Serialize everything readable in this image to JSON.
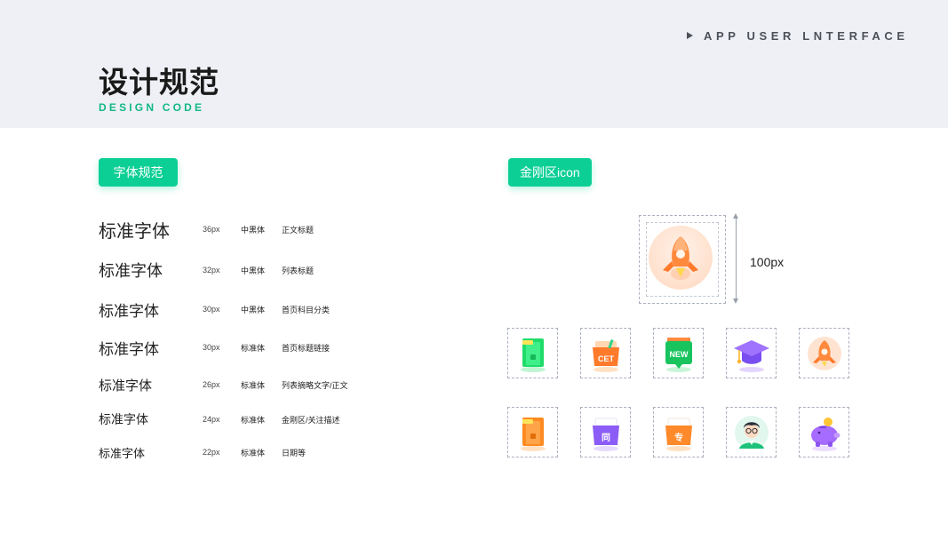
{
  "header": {
    "top_right": "APP USER LNTERFACE",
    "title": "设计规范",
    "subtitle": "DESIGN CODE"
  },
  "sections": {
    "font_tag": "字体规范",
    "icon_tag": "金刚区icon"
  },
  "font_specs": [
    {
      "sample": "标准字体",
      "size": "36px",
      "weight": "中黑体",
      "usage": "正文标题"
    },
    {
      "sample": "标准字体",
      "size": "32px",
      "weight": "中黑体",
      "usage": "列表标题"
    },
    {
      "sample": "标准字体",
      "size": "30px",
      "weight": "中黑体",
      "usage": "首页科目分类"
    },
    {
      "sample": "标准字体",
      "size": "30px",
      "weight": "标准体",
      "usage": "首页标题链接"
    },
    {
      "sample": "标准字体",
      "size": "26px",
      "weight": "标准体",
      "usage": "列表摘略文字/正文"
    },
    {
      "sample": "标准字体",
      "size": "24px",
      "weight": "标准体",
      "usage": "金刚区/关注描述"
    },
    {
      "sample": "标准字体",
      "size": "22px",
      "weight": "标准体",
      "usage": "日期等"
    }
  ],
  "icon_spec": {
    "dimension_label": "100px",
    "big_icon": "rocket-icon"
  },
  "icon_grid": {
    "row1": [
      {
        "icon": "green-door-icon"
      },
      {
        "icon": "cet-box-icon",
        "label": "CET"
      },
      {
        "icon": "new-badge-icon",
        "label": "NEW"
      },
      {
        "icon": "graduation-cap-icon"
      },
      {
        "icon": "rocket-icon"
      }
    ],
    "row2": [
      {
        "icon": "orange-door-icon"
      },
      {
        "icon": "purple-folder-icon",
        "label": "同"
      },
      {
        "icon": "orange-folder-icon",
        "label": "专"
      },
      {
        "icon": "teacher-avatar-icon"
      },
      {
        "icon": "piggy-bank-icon"
      }
    ]
  },
  "colors": {
    "accent": "#0ccf95",
    "header_bg": "#eef0f5",
    "subtitle": "#12b886"
  }
}
